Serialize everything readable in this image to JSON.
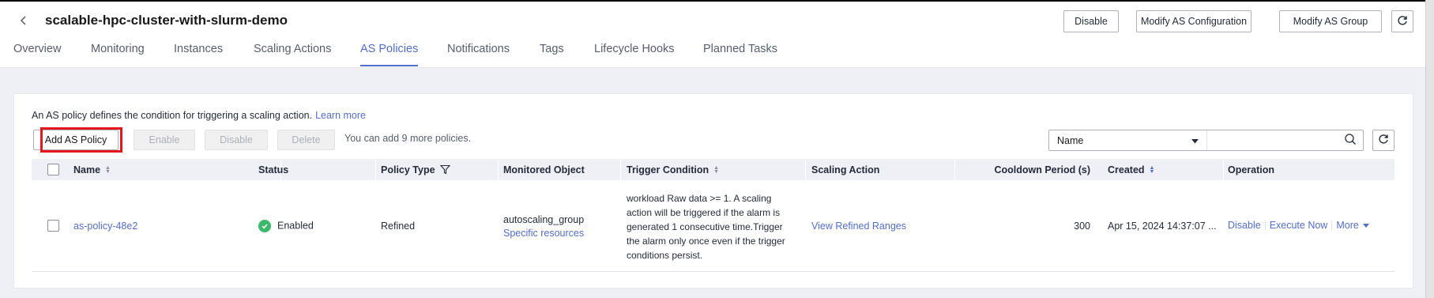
{
  "header": {
    "title": "scalable-hpc-cluster-with-slurm-demo",
    "buttons": {
      "disable": "Disable",
      "modify_config": "Modify AS Configuration",
      "modify_group": "Modify AS Group"
    }
  },
  "tabs": [
    {
      "label": "Overview",
      "active": false
    },
    {
      "label": "Monitoring",
      "active": false
    },
    {
      "label": "Instances",
      "active": false
    },
    {
      "label": "Scaling Actions",
      "active": false
    },
    {
      "label": "AS Policies",
      "active": true
    },
    {
      "label": "Notifications",
      "active": false
    },
    {
      "label": "Tags",
      "active": false
    },
    {
      "label": "Lifecycle Hooks",
      "active": false
    },
    {
      "label": "Planned Tasks",
      "active": false
    }
  ],
  "policies": {
    "description": "An AS policy defines the condition for triggering a scaling action.",
    "learn_more": "Learn more",
    "toolbar": {
      "add": "Add AS Policy",
      "enable": "Enable",
      "disable": "Disable",
      "delete": "Delete"
    },
    "quota_text": "You can add 9 more policies.",
    "search": {
      "filter_selected": "Name",
      "value": ""
    },
    "columns": {
      "name": "Name",
      "status": "Status",
      "policy_type": "Policy Type",
      "monitored_object": "Monitored Object",
      "trigger_condition": "Trigger Condition",
      "scaling_action": "Scaling Action",
      "cooldown": "Cooldown Period (s)",
      "created": "Created",
      "operation": "Operation"
    },
    "rows": [
      {
        "name": "as-policy-48e2",
        "status": "Enabled",
        "policy_type": "Refined",
        "monitored_object": "autoscaling_group",
        "monitored_link": "Specific resources",
        "trigger_condition": "workload Raw data >= 1. A scaling action will be triggered if the alarm is generated 1 consecutive time.Trigger the alarm only once even if the trigger conditions persist.",
        "scaling_action": "View Refined Ranges",
        "cooldown": "300",
        "created": "Apr 15, 2024 14:37:07 ...",
        "ops": {
          "disable": "Disable",
          "execute": "Execute Now",
          "more": "More"
        }
      }
    ]
  },
  "colors": {
    "accent": "#526ecc",
    "status_ok": "#3bb86a",
    "highlight": "#e5161c"
  }
}
